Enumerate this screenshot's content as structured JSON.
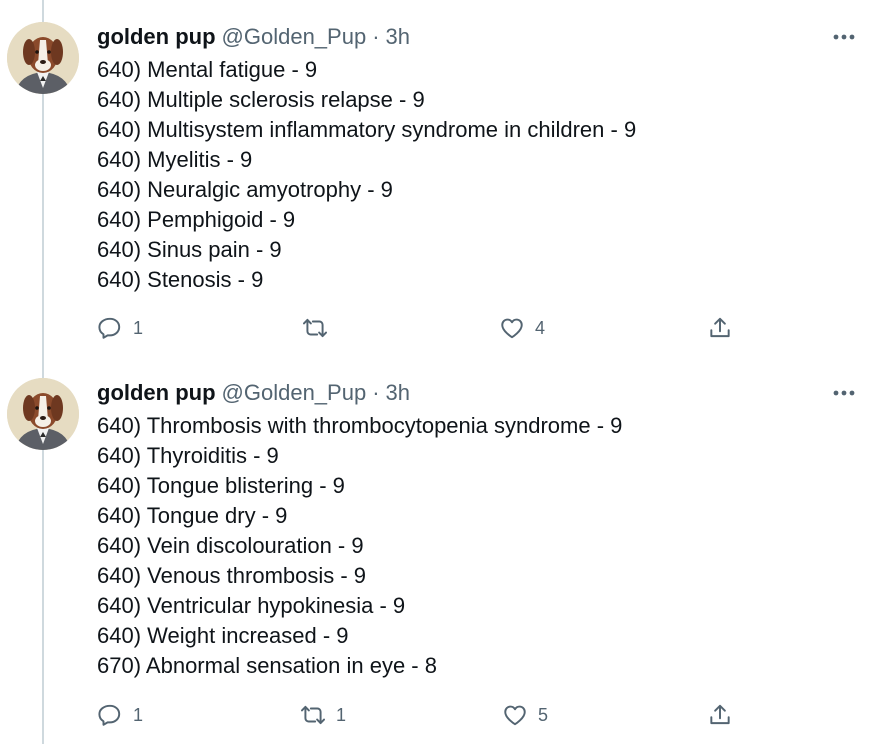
{
  "tweets": [
    {
      "author_name": "golden pup",
      "handle": "@Golden_Pup",
      "separator": "·",
      "time": "3h",
      "lines": [
        "640) Mental fatigue - 9",
        "640) Multiple sclerosis relapse - 9",
        "640) Multisystem inflammatory syndrome in children - 9",
        "640) Myelitis - 9",
        "640) Neuralgic amyotrophy - 9",
        "640) Pemphigoid - 9",
        "640) Sinus pain - 9",
        "640) Stenosis - 9"
      ],
      "reply_count": "1",
      "retweet_count": "",
      "like_count": "4"
    },
    {
      "author_name": "golden pup",
      "handle": "@Golden_Pup",
      "separator": "·",
      "time": "3h",
      "lines": [
        "640) Thrombosis with thrombocytopenia syndrome - 9",
        "640) Thyroiditis - 9",
        "640) Tongue blistering - 9",
        "640) Tongue dry - 9",
        "640) Vein discolouration - 9",
        "640) Venous thrombosis - 9",
        "640) Ventricular hypokinesia - 9",
        "640) Weight increased - 9",
        "670) Abnormal sensation in eye - 8"
      ],
      "reply_count": "1",
      "retweet_count": "1",
      "like_count": "5"
    }
  ],
  "icons": {
    "reply": "reply-icon",
    "retweet": "retweet-icon",
    "like": "like-icon",
    "share": "share-icon",
    "more": "more-icon"
  },
  "colors": {
    "text": "#0f1419",
    "secondary": "#536471",
    "thread_line": "#cfd9de"
  }
}
